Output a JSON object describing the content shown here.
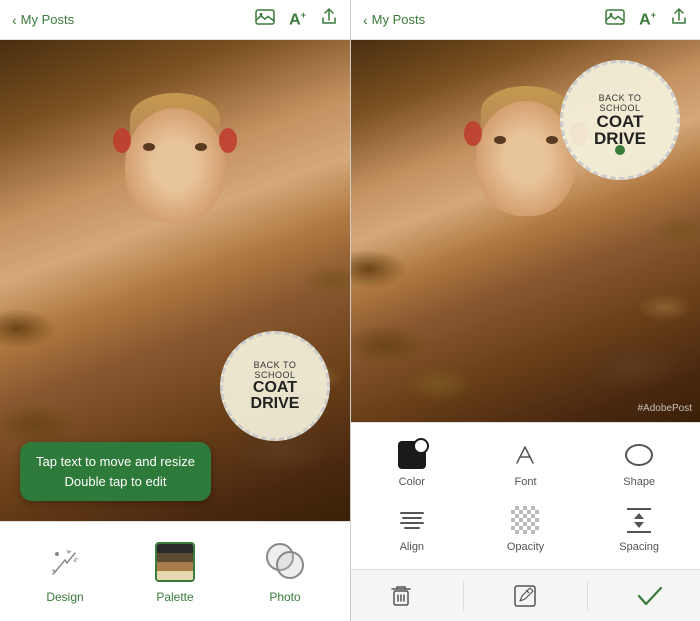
{
  "left_panel": {
    "top_bar": {
      "back_label": "My Posts",
      "share_icon": "share-icon",
      "image_icon": "image-icon",
      "text_icon": "text-icon"
    },
    "badge": {
      "line1": "BACK TO",
      "line2": "SCHOOL",
      "line3": "COAT",
      "line4": "DRIVE"
    },
    "tooltip": {
      "line1": "Tap text to move and resize",
      "line2": "Double tap to edit"
    },
    "toolbar": {
      "design_label": "Design",
      "palette_label": "Palette",
      "photo_label": "Photo"
    }
  },
  "right_panel": {
    "top_bar": {
      "back_label": "My Posts",
      "share_icon": "share-icon",
      "image_icon": "image-icon",
      "text_icon": "text-icon"
    },
    "badge": {
      "line1": "BACK TO",
      "line2": "SCHOOL",
      "line3": "COAT",
      "line4": "DRIVE"
    },
    "watermark": "#AdobePost",
    "toolbar": {
      "items": [
        {
          "label": "Color",
          "icon": "color-icon"
        },
        {
          "label": "Font",
          "icon": "font-icon"
        },
        {
          "label": "Shape",
          "icon": "shape-icon"
        },
        {
          "label": "Align",
          "icon": "align-icon"
        },
        {
          "label": "Opacity",
          "icon": "opacity-icon"
        },
        {
          "label": "Spacing",
          "icon": "spacing-icon"
        }
      ]
    },
    "actions": {
      "delete_label": "delete",
      "edit_label": "edit",
      "confirm_label": "confirm"
    }
  }
}
